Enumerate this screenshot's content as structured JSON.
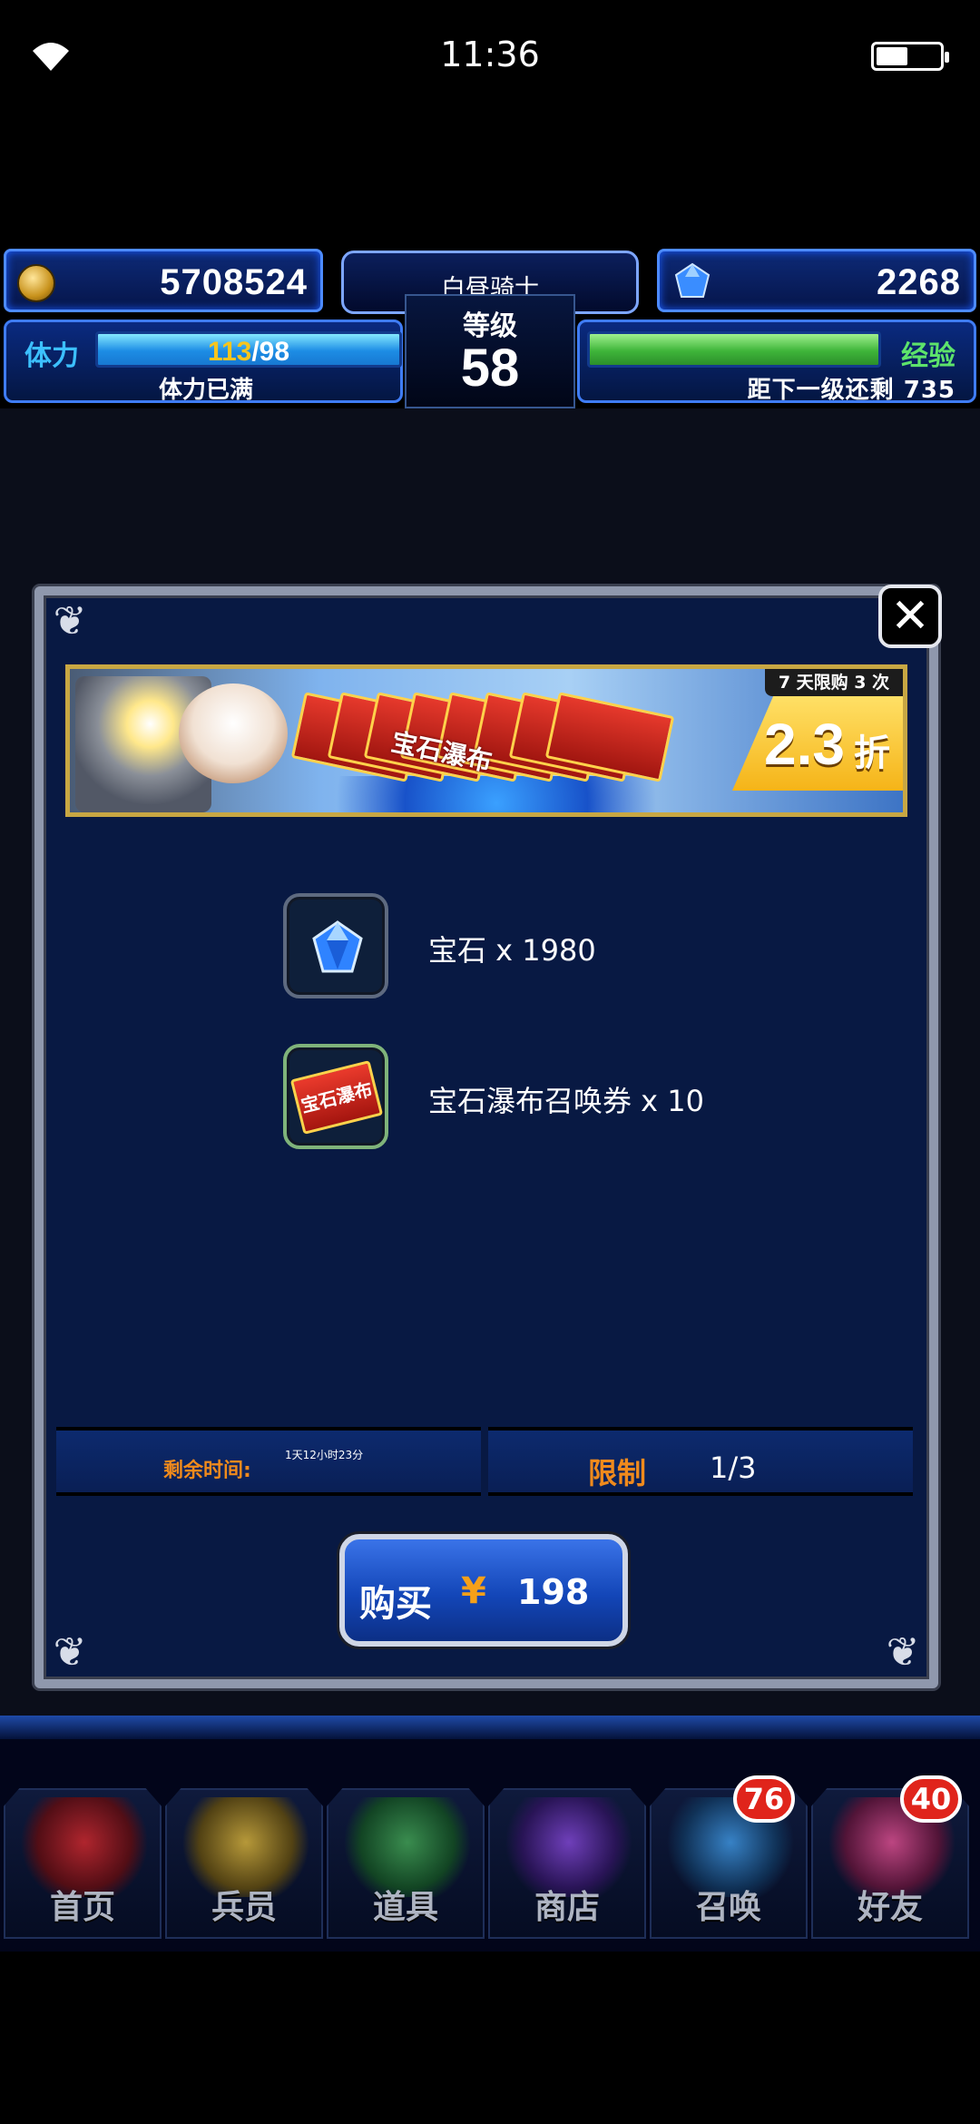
{
  "status_bar": {
    "time": "11:36"
  },
  "hud": {
    "gold": "5708524",
    "gems": "2268",
    "title": "白昼骑士",
    "level_label": "等级",
    "level": "58",
    "stamina_label": "体力",
    "stamina_current": "113",
    "stamina_max": "/98",
    "stamina_status": "体力已满",
    "stamina_fill": 1.0,
    "exp_label": "经验",
    "exp_remaining_text": "距下一级还剩 735",
    "exp_fill": 1.0
  },
  "modal": {
    "banner": {
      "ticket_text": "宝石瀑布",
      "limit_badge": "7 天限购 3 次",
      "discount": "2.3",
      "discount_unit": "折"
    },
    "items": [
      {
        "label": "宝石 x 1980",
        "icon": "gem-icon"
      },
      {
        "label": "宝石瀑布召唤券 x 10",
        "icon": "ticket-icon",
        "icon_text": "宝石瀑布"
      }
    ],
    "remaining_label": "剩余时间:",
    "remaining_value": "1天12小时23分",
    "limit_label": "限制",
    "limit_value": "1/3",
    "buy_label": "购买",
    "currency_symbol": "¥",
    "price": "198"
  },
  "bottom_nav": [
    {
      "label": "首页",
      "color": "#c2272d"
    },
    {
      "label": "兵员",
      "color": "#c9a73a"
    },
    {
      "label": "道具",
      "color": "#3f9a52"
    },
    {
      "label": "商店",
      "color": "#7a44c9"
    },
    {
      "label": "召唤",
      "color": "#3c8ed6",
      "badge": "76"
    },
    {
      "label": "好友",
      "color": "#d04b8a",
      "badge": "40"
    }
  ]
}
